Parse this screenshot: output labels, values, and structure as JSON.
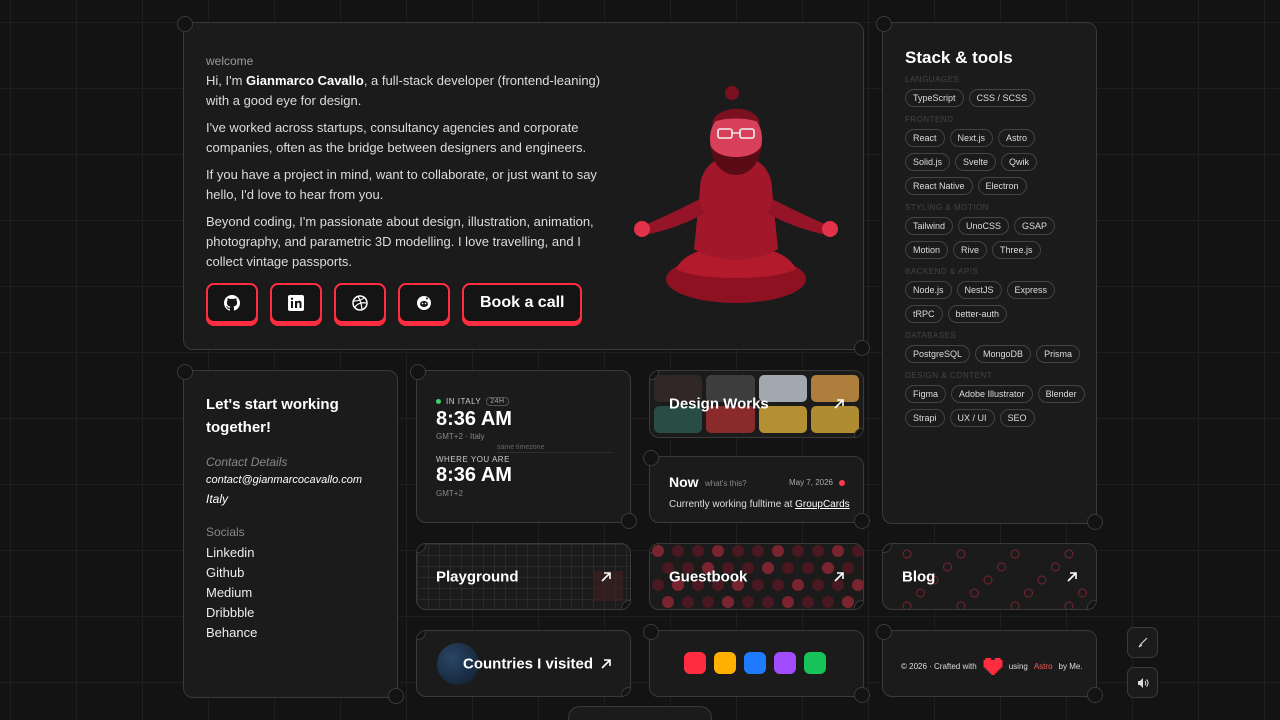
{
  "hero": {
    "welcome": "welcome",
    "intro_prefix": "Hi, I'm ",
    "name": "Gianmarco Cavallo",
    "intro_suffix": ", a full-stack developer (frontend-leaning) with a good eye for design.",
    "p2": "I've worked across startups, consultancy agencies and corporate companies, often as the bridge between designers and engineers.",
    "p3": "If you have a project in mind, want to collaborate, or just want to say hello, I'd love to hear from you.",
    "p4": "Beyond coding, I'm passionate about design, illustration, animation, photography, and parametric 3D modelling. I love travelling, and I collect vintage passports.",
    "book_call": "Book a call",
    "social_icons": [
      "github-icon",
      "linkedin-icon",
      "dribbble-icon",
      "reddit-icon"
    ]
  },
  "stack": {
    "title": "Stack & tools",
    "groups": [
      {
        "title": "LANGUAGES",
        "items": [
          "TypeScript",
          "CSS / SCSS"
        ]
      },
      {
        "title": "FRONTEND",
        "items": [
          "React",
          "Next.js",
          "Astro",
          "Solid.js",
          "Svelte",
          "Qwik",
          "React Native",
          "Electron"
        ]
      },
      {
        "title": "STYLING & MOTION",
        "items": [
          "Tailwind",
          "UnoCSS",
          "GSAP",
          "Motion",
          "Rive",
          "Three.js"
        ]
      },
      {
        "title": "BACKEND & APIS",
        "items": [
          "Node.js",
          "NestJS",
          "Express",
          "tRPC",
          "better-auth"
        ]
      },
      {
        "title": "DATABASES",
        "items": [
          "PostgreSQL",
          "MongoDB",
          "Prisma"
        ]
      },
      {
        "title": "DESIGN & CONTENT",
        "items": [
          "Figma",
          "Adobe Illustrator",
          "Blender",
          "Strapi",
          "UX / UI",
          "SEO"
        ]
      }
    ]
  },
  "contact": {
    "title": "Let's start working together!",
    "details_label": "Contact Details",
    "email": "contact@gianmarcocavallo.com",
    "country": "Italy",
    "socials_label": "Socials",
    "socials": [
      "Linkedin",
      "Github",
      "Medium",
      "Dribbble",
      "Behance"
    ]
  },
  "time": {
    "local_label": "IN ITALY",
    "format_chip": "24H",
    "local_time": "8:36 AM",
    "local_tz": "GMT+2 · Italy",
    "same_tz": "same timezone",
    "where_label": "WHERE YOU ARE",
    "your_time": "8:36 AM",
    "your_tz": "GMT+2"
  },
  "tiles": {
    "design": "Design Works",
    "playground": "Playground",
    "guestbook": "Guestbook",
    "blog": "Blog",
    "countries": "Countries I visited"
  },
  "now": {
    "title": "Now",
    "question": "what's this?",
    "date": "May 7, 2026",
    "text_prefix": "Currently working fulltime at ",
    "company": "GroupCards"
  },
  "flags": [
    "#ff2d3f",
    "#ffb000",
    "#1e7bff",
    "#a24cff",
    "#16c45a"
  ],
  "footer": {
    "copy": "© 2026 · Crafted with",
    "using": "using",
    "astro": "Astro",
    "by": "by Me."
  },
  "colors": {
    "accent": "#ff2d3f",
    "background": "#131313",
    "card": "#1b1b1b"
  }
}
